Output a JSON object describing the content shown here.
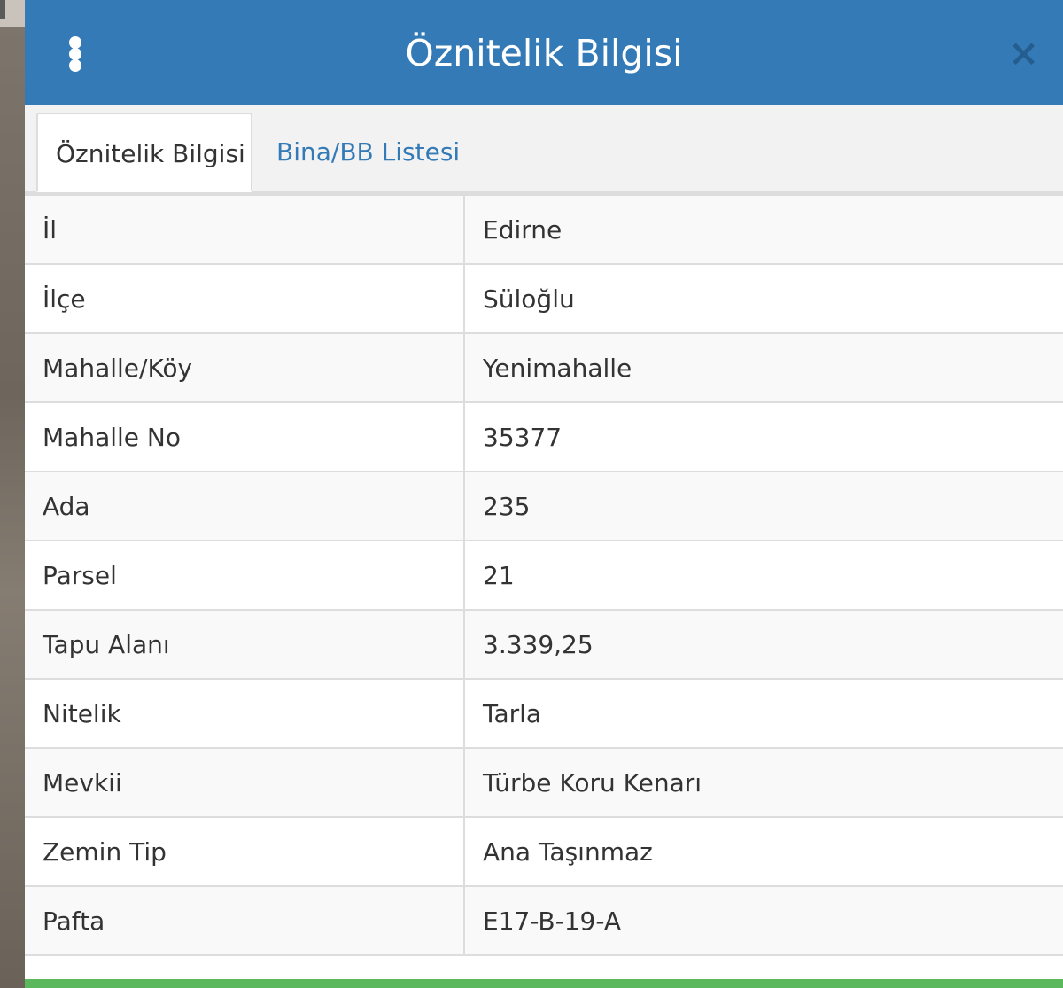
{
  "header": {
    "title": "Öznitelik Bilgisi"
  },
  "tabs": [
    {
      "label": "Öznitelik Bilgisi",
      "active": true
    },
    {
      "label": "Bina/BB Listesi",
      "active": false
    }
  ],
  "attributes": [
    {
      "label": "İl",
      "value": "Edirne"
    },
    {
      "label": "İlçe",
      "value": "Süloğlu"
    },
    {
      "label": "Mahalle/Köy",
      "value": "Yenimahalle"
    },
    {
      "label": "Mahalle No",
      "value": "35377"
    },
    {
      "label": "Ada",
      "value": "235"
    },
    {
      "label": "Parsel",
      "value": "21"
    },
    {
      "label": "Tapu Alanı",
      "value": "3.339,25"
    },
    {
      "label": "Nitelik",
      "value": "Tarla"
    },
    {
      "label": "Mevkii",
      "value": "Türbe Koru Kenarı"
    },
    {
      "label": "Zemin Tip",
      "value": "Ana Taşınmaz"
    },
    {
      "label": "Pafta",
      "value": "E17-B-19-A"
    }
  ],
  "icons": {
    "menu": "vertical-dots-icon",
    "close": "close-icon",
    "close_glyph": "×"
  },
  "colors": {
    "header_bg": "#337ab7",
    "tab_link": "#337ab7",
    "footer_bar": "#5cb85c"
  }
}
